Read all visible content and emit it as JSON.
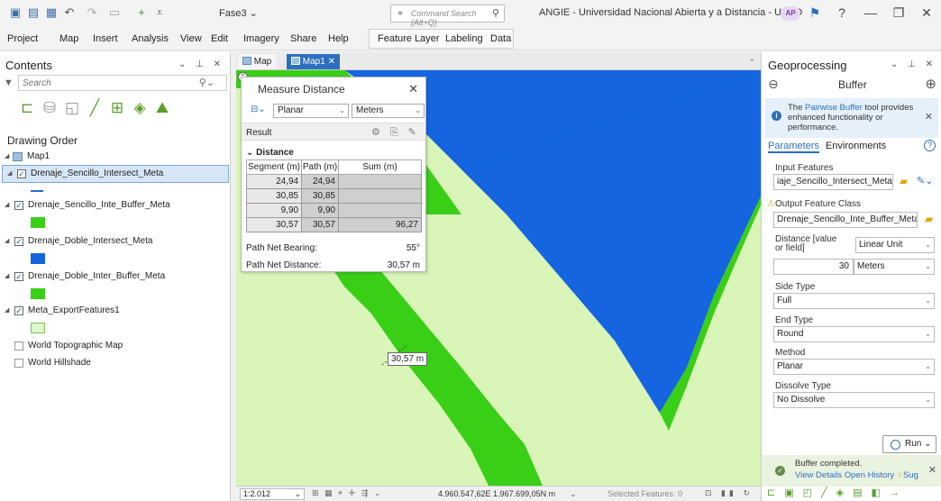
{
  "titlebar": {
    "project": "Fase3",
    "command_search_placeholder": "Command Search (Alt+Q)",
    "window_title": "ANGIE - Universidad Nacional Abierta y a Distancia - UNAD",
    "avatar": "AP",
    "help": "?",
    "minimize": "—",
    "restore": "❐",
    "close": "✕"
  },
  "menu": {
    "items": [
      "Project",
      "Map",
      "Insert",
      "Analysis",
      "View",
      "Edit",
      "Imagery",
      "Share",
      "Help"
    ],
    "context_tabs": [
      "Feature Layer",
      "Labeling",
      "Data"
    ]
  },
  "contents": {
    "title": "Contents",
    "search_placeholder": "Search",
    "drawing_order": "Drawing Order",
    "map_name": "Map1",
    "layers": [
      {
        "name": "Drenaje_Sencillo_Intersect_Meta",
        "checked": true,
        "color": "#1f6fd6",
        "symbol": "line"
      },
      {
        "name": "Drenaje_Sencillo_Inte_Buffer_Meta",
        "checked": true,
        "color": "#39cf17",
        "symbol": "fill"
      },
      {
        "name": "Drenaje_Doble_Intersect_Meta",
        "checked": true,
        "color": "#1565e0",
        "symbol": "fill"
      },
      {
        "name": "Drenaje_Doble_Inter_Buffer_Meta",
        "checked": true,
        "color": "#39cf17",
        "symbol": "fill"
      },
      {
        "name": "Meta_ExportFeatures1",
        "checked": true,
        "color": "#dcf8c8",
        "symbol": "fill"
      }
    ],
    "basemaps": [
      "World Topographic Map",
      "World Hillshade"
    ]
  },
  "map": {
    "tabs": [
      "Map",
      "Map1"
    ],
    "measure_label": "30,57 m",
    "scale": "1:2.012",
    "coords": "4.960.547,62E 1.967.699,05N m",
    "selected_features": "Selected Features: 0"
  },
  "measure": {
    "title": "Measure Distance",
    "mode": "Planar",
    "units": "Meters",
    "result_label": "Result",
    "distance_header": "Distance",
    "columns": [
      "Segment (m)",
      "Path (m)",
      "Sum (m)"
    ],
    "rows": [
      {
        "segment": "24,94",
        "path": "24,94",
        "sum": ""
      },
      {
        "segment": "30,85",
        "path": "30,85",
        "sum": ""
      },
      {
        "segment": "9,90",
        "path": "9,90",
        "sum": ""
      },
      {
        "segment": "30,57",
        "path": "30,57",
        "sum": "96,27"
      }
    ],
    "bearing_label": "Path Net Bearing:",
    "bearing_value": "55°",
    "distance_label": "Path Net Distance:",
    "distance_value": "30,57 m"
  },
  "geo": {
    "title": "Geoprocessing",
    "tool": "Buffer",
    "info_pre": "The ",
    "info_link": "Pairwise Buffer",
    "info_post": " tool provides enhanced functionality or performance.",
    "tab_params": "Parameters",
    "tab_env": "Environments",
    "input_label": "Input Features",
    "input_value": "iaje_Sencillo_Intersect_Meta",
    "output_label": "Output Feature Class",
    "output_value": "Drenaje_Sencillo_Inte_Buffer_Meta",
    "distance_label": "Distance [value or field]",
    "distance_type": "Linear Unit",
    "distance_value": "30",
    "distance_unit": "Meters",
    "side_label": "Side Type",
    "side_value": "Full",
    "end_label": "End Type",
    "end_value": "Round",
    "method_label": "Method",
    "method_value": "Planar",
    "dissolve_label": "Dissolve Type",
    "dissolve_value": "No Dissolve",
    "run": "Run",
    "msg": "Buffer completed.",
    "msg_details": "View Details",
    "msg_history": "Open History",
    "msg_sug": "Sug"
  }
}
